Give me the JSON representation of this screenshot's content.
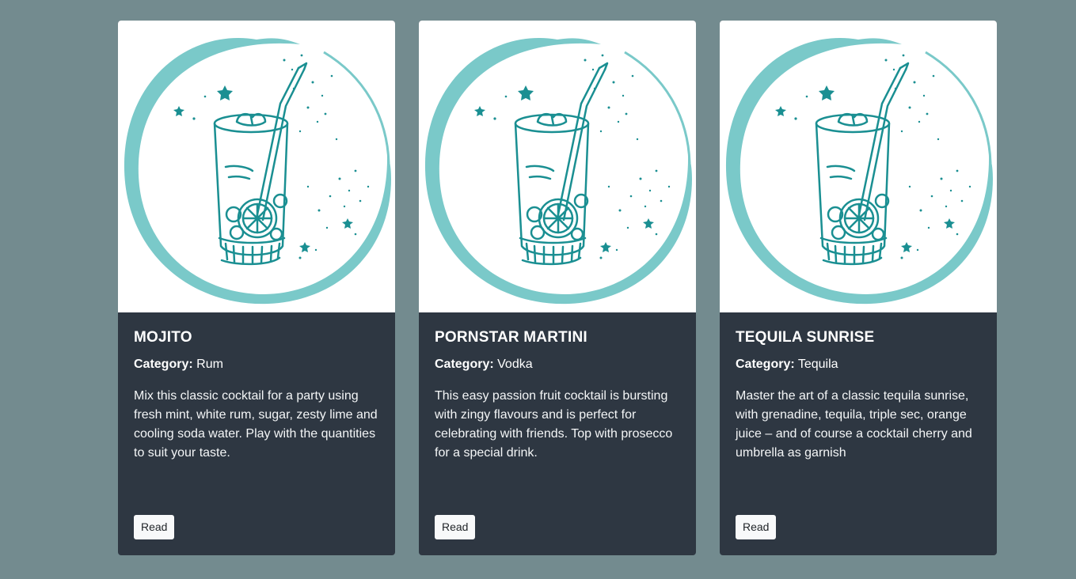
{
  "colors": {
    "page_background": "#738b8f",
    "card_background": "#2e3742",
    "illustration_teal": "#1a8f92",
    "illustration_ring": "#7ac9c9",
    "button_background": "#f8f9fa"
  },
  "cards": [
    {
      "title": "MOJITO",
      "category_label": "Category:",
      "category": "Rum",
      "description": "Mix this classic cocktail for a party using fresh mint, white rum, sugar, zesty lime and cooling soda water. Play with the quantities to suit your taste.",
      "button_label": "Read",
      "image_icon": "cocktail-glass-illustration"
    },
    {
      "title": "PORNSTAR MARTINI",
      "category_label": "Category:",
      "category": "Vodka",
      "description": "This easy passion fruit cocktail is bursting with zingy flavours and is perfect for celebrating with friends. Top with prosecco for a special drink.",
      "button_label": "Read",
      "image_icon": "cocktail-glass-illustration"
    },
    {
      "title": "TEQUILA SUNRISE",
      "category_label": "Category:",
      "category": "Tequila",
      "description": "Master the art of a classic tequila sunrise, with grenadine, tequila, triple sec, orange juice – and of course a cocktail cherry and umbrella as garnish",
      "button_label": "Read",
      "image_icon": "cocktail-glass-illustration"
    }
  ]
}
